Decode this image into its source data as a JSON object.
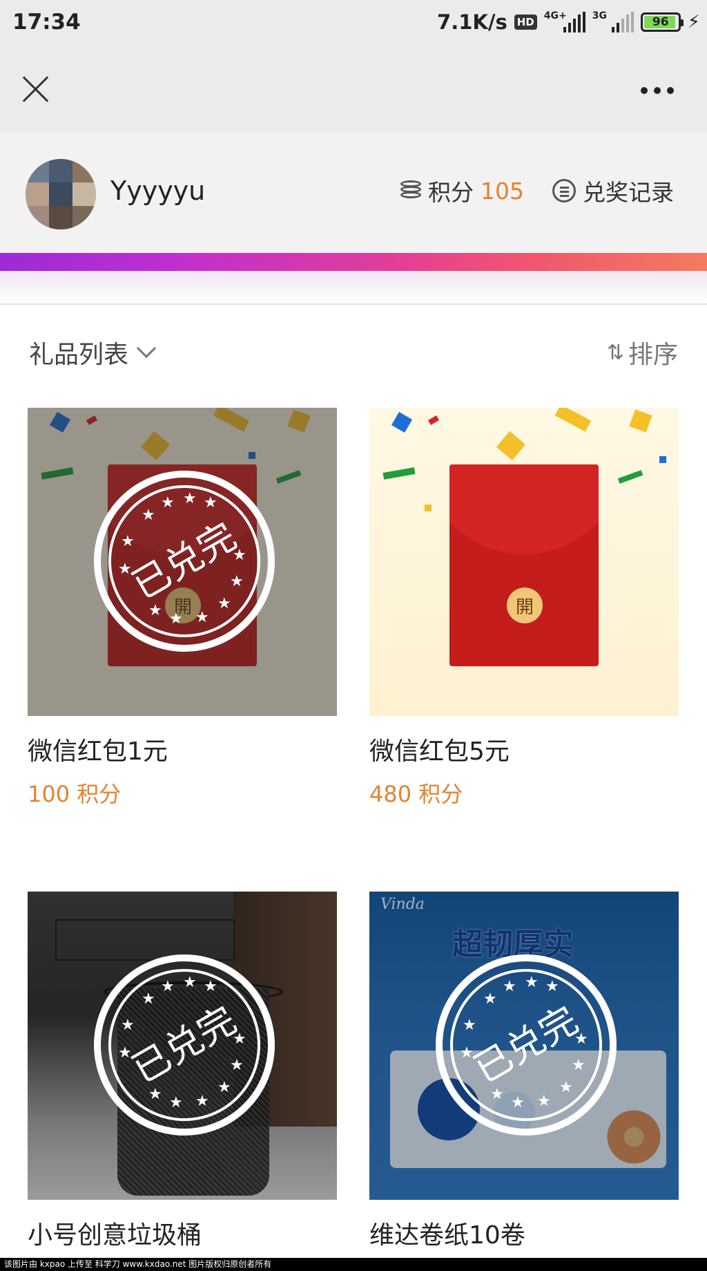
{
  "status_bar": {
    "time": "17:34",
    "net_speed": "7.1K/s",
    "hd": "HD",
    "signal_1_label": "4G+",
    "signal_2_label": "3G",
    "battery": "96"
  },
  "nav": {
    "close_icon": "close-icon",
    "more_icon": "more-icon"
  },
  "user": {
    "name": "Yyyyyu",
    "points_label": "积分",
    "points_value": "105",
    "records_label": "兑奖记录"
  },
  "list_header": {
    "title": "礼品列表",
    "sort_icon": "⇅",
    "sort_label": "排序"
  },
  "gifts": [
    {
      "name": "微信红包1元",
      "points": "100 积分",
      "stamp": "已兑完",
      "seal": "開"
    },
    {
      "name": "微信红包5元",
      "points": "480 积分",
      "seal": "開"
    },
    {
      "name": "小号创意垃圾桶",
      "stamp": "已兑完"
    },
    {
      "name": "维达卷纸10卷",
      "stamp": "已兑完",
      "image_text": {
        "brand": "Vinda",
        "slogan": "超韧厚实"
      }
    }
  ],
  "colors": {
    "accent": "#e6822e",
    "header_bg": "#ebebeb",
    "envelope_red": "#c51c1c"
  },
  "footer": {
    "watermark": "该图片由 kxpao 上传至 科学刀 www.kxdao.net 图片版权归原创者所有"
  }
}
